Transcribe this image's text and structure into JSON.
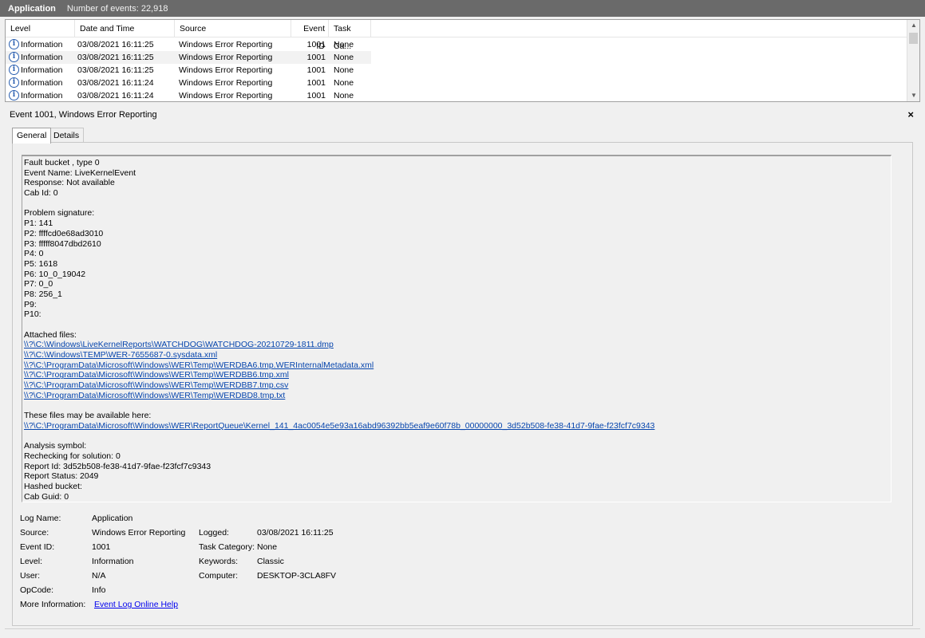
{
  "titlebar": {
    "app": "Application",
    "count": "Number of events: 22,918"
  },
  "columns": [
    "Level",
    "Date and Time",
    "Source",
    "Event ID",
    "Task Ca..."
  ],
  "rows": [
    {
      "level": "Information",
      "datetime": "03/08/2021 16:11:25",
      "source": "Windows Error Reporting",
      "event_id": "1001",
      "task": "None"
    },
    {
      "level": "Information",
      "datetime": "03/08/2021 16:11:25",
      "source": "Windows Error Reporting",
      "event_id": "1001",
      "task": "None"
    },
    {
      "level": "Information",
      "datetime": "03/08/2021 16:11:25",
      "source": "Windows Error Reporting",
      "event_id": "1001",
      "task": "None"
    },
    {
      "level": "Information",
      "datetime": "03/08/2021 16:11:24",
      "source": "Windows Error Reporting",
      "event_id": "1001",
      "task": "None"
    },
    {
      "level": "Information",
      "datetime": "03/08/2021 16:11:24",
      "source": "Windows Error Reporting",
      "event_id": "1001",
      "task": "None"
    }
  ],
  "details": {
    "title": "Event 1001, Windows Error Reporting",
    "close": "×",
    "tabs": [
      "General",
      "Details"
    ]
  },
  "description": [
    {
      "text": "Fault bucket , type 0"
    },
    {
      "text": "Event Name: LiveKernelEvent"
    },
    {
      "text": "Response: Not available"
    },
    {
      "text": "Cab Id: 0"
    },
    {
      "text": ""
    },
    {
      "text": "Problem signature:"
    },
    {
      "text": "P1: 141"
    },
    {
      "text": "P2: ffffcd0e68ad3010"
    },
    {
      "text": "P3: fffff8047dbd2610"
    },
    {
      "text": "P4: 0"
    },
    {
      "text": "P5: 1618"
    },
    {
      "text": "P6: 10_0_19042"
    },
    {
      "text": "P7: 0_0"
    },
    {
      "text": "P8: 256_1"
    },
    {
      "text": "P9:"
    },
    {
      "text": "P10:"
    },
    {
      "text": ""
    },
    {
      "text": "Attached files:"
    },
    {
      "text": "\\\\?\\C:\\Windows\\LiveKernelReports\\WATCHDOG\\WATCHDOG-20210729-1811.dmp",
      "link": true
    },
    {
      "text": "\\\\?\\C:\\Windows\\TEMP\\WER-7655687-0.sysdata.xml",
      "link": true
    },
    {
      "text": "\\\\?\\C:\\ProgramData\\Microsoft\\Windows\\WER\\Temp\\WERDBA6.tmp.WERInternalMetadata.xml",
      "link": true
    },
    {
      "text": "\\\\?\\C:\\ProgramData\\Microsoft\\Windows\\WER\\Temp\\WERDBB6.tmp.xml",
      "link": true
    },
    {
      "text": "\\\\?\\C:\\ProgramData\\Microsoft\\Windows\\WER\\Temp\\WERDBB7.tmp.csv",
      "link": true
    },
    {
      "text": "\\\\?\\C:\\ProgramData\\Microsoft\\Windows\\WER\\Temp\\WERDBD8.tmp.txt",
      "link": true
    },
    {
      "text": ""
    },
    {
      "text": "These files may be available here:"
    },
    {
      "text": "\\\\?\\C:\\ProgramData\\Microsoft\\Windows\\WER\\ReportQueue\\Kernel_141_4ac0054e5e93a16abd96392bb5eaf9e60f78b_00000000_3d52b508-fe38-41d7-9fae-f23fcf7c9343",
      "link": true
    },
    {
      "text": ""
    },
    {
      "text": "Analysis symbol:"
    },
    {
      "text": "Rechecking for solution: 0"
    },
    {
      "text": "Report Id: 3d52b508-fe38-41d7-9fae-f23fcf7c9343"
    },
    {
      "text": "Report Status: 2049"
    },
    {
      "text": "Hashed bucket:"
    },
    {
      "text": "Cab Guid: 0"
    }
  ],
  "props": {
    "log_name_label": "Log Name:",
    "log_name": "Application",
    "source_label": "Source:",
    "source": "Windows Error Reporting",
    "logged_label": "Logged:",
    "logged": "03/08/2021 16:11:25",
    "event_id_label": "Event ID:",
    "event_id": "1001",
    "task_category_label": "Task Category:",
    "task_category": "None",
    "level_label": "Level:",
    "level": "Information",
    "keywords_label": "Keywords:",
    "keywords": "Classic",
    "user_label": "User:",
    "user": "N/A",
    "computer_label": "Computer:",
    "computer": "DESKTOP-3CLA8FV",
    "opcode_label": "OpCode:",
    "opcode": "Info",
    "more_info_label": "More Information:",
    "more_info_link": "Event Log Online Help"
  }
}
